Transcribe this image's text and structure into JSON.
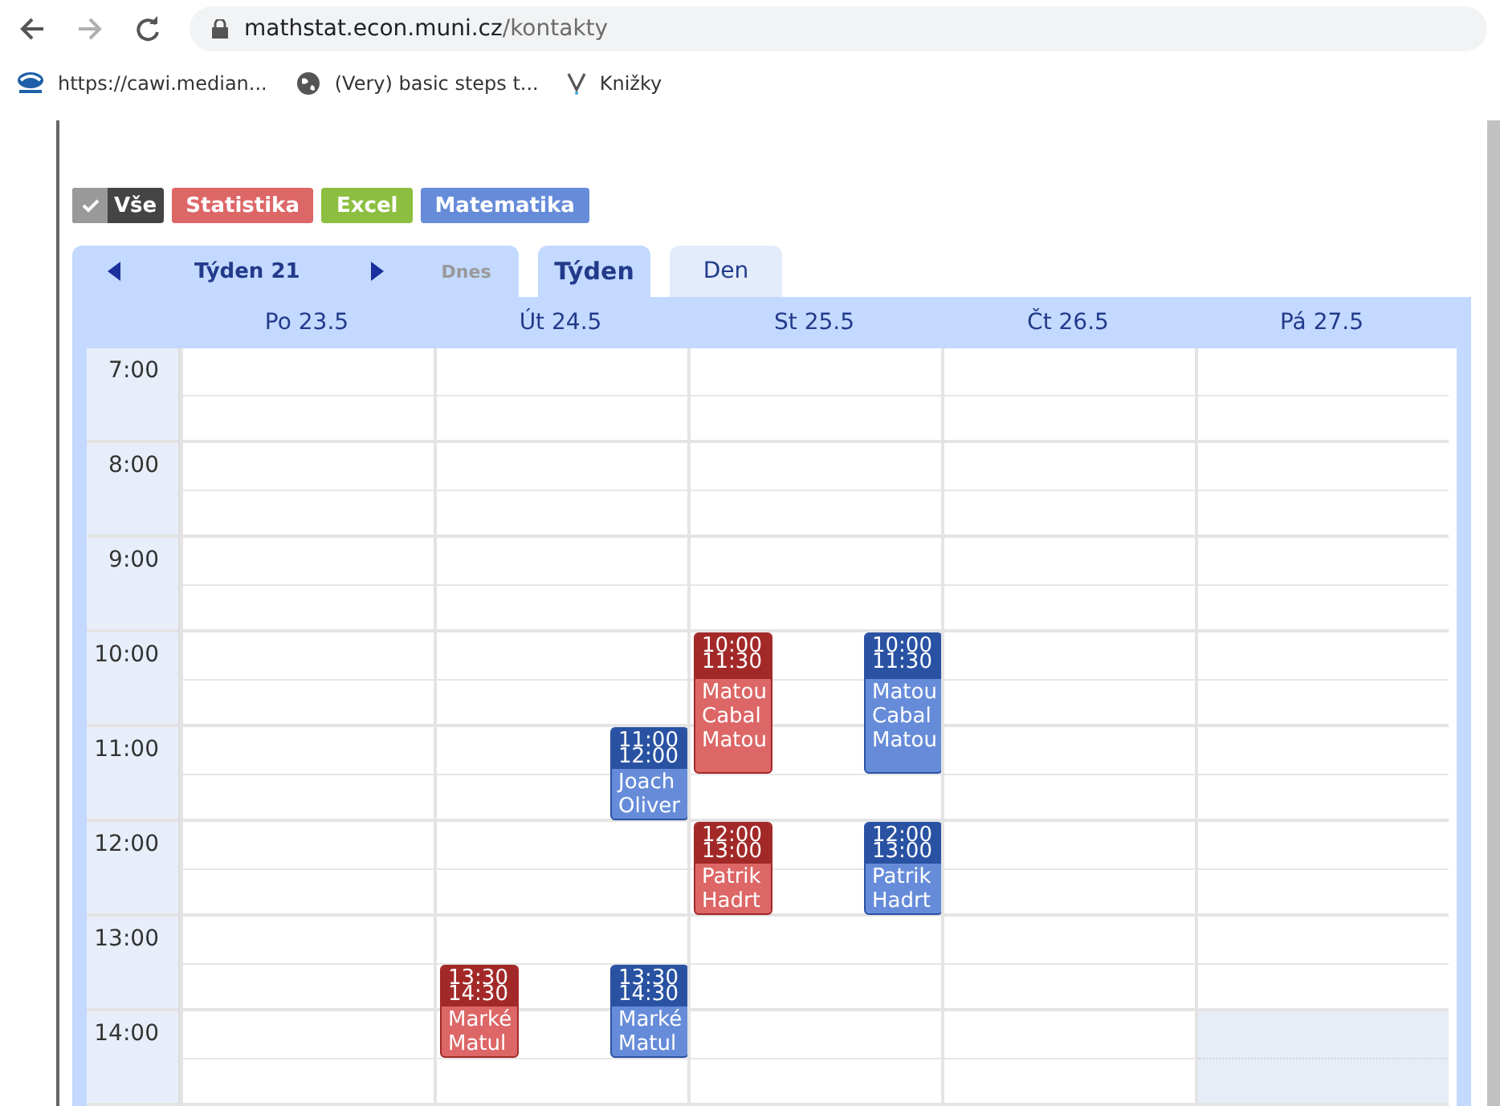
{
  "browser": {
    "url_host": "mathstat.econ.muni.cz",
    "url_path": "/kontakty",
    "forward_disabled": true,
    "bookmarks": [
      {
        "kind": "logo",
        "label": "https://cawi.median..."
      },
      {
        "kind": "globe",
        "label": "(Very) basic steps t..."
      },
      {
        "kind": "v",
        "label": "Knižky"
      }
    ]
  },
  "filters": [
    {
      "kind": "all",
      "label": "Vše",
      "checked": true,
      "color": "#444444"
    },
    {
      "kind": "category",
      "label": "Statistika",
      "color": "#dd6666"
    },
    {
      "kind": "category",
      "label": "Excel",
      "color": "#8cbf40"
    },
    {
      "kind": "category",
      "label": "Matematika",
      "color": "#668cd9"
    }
  ],
  "nav": {
    "week_label": "Týden 21",
    "today": {
      "label": "Dnes",
      "disabled": true
    },
    "views": [
      {
        "label": "Týden",
        "selected": true
      },
      {
        "label": "Den",
        "selected": false
      }
    ]
  },
  "days": [
    {
      "label": "Po 23.5"
    },
    {
      "label": "Út 24.5",
      "events": [
        {
          "kind": "mat",
          "color": "#2952a3",
          "time_start": "11:00",
          "time_end": "12:00",
          "lines": [
            "Joach",
            "Oliver"
          ]
        },
        {
          "kind": "stat",
          "color": "#a32929",
          "time_start": "13:30",
          "time_end": "14:30",
          "lines": [
            "Marké",
            "Matul"
          ]
        },
        {
          "kind": "mat",
          "color": "#2952a3",
          "time_start": "13:30",
          "time_end": "14:30",
          "lines": [
            "Marké",
            "Matul"
          ]
        }
      ]
    },
    {
      "label": "St 25.5",
      "events": [
        {
          "kind": "stat",
          "color": "#a32929",
          "time_start": "10:00",
          "time_end": "11:30",
          "lines": [
            "Matou",
            "Cabal",
            "Matou"
          ]
        },
        {
          "kind": "mat",
          "color": "#2952a3",
          "time_start": "10:00",
          "time_end": "11:30",
          "lines": [
            "Matou",
            "Cabal",
            "Matou"
          ]
        },
        {
          "kind": "stat",
          "color": "#a32929",
          "time_start": "12:00",
          "time_end": "13:00",
          "lines": [
            "Patrik",
            "Hadrt"
          ]
        },
        {
          "kind": "mat",
          "color": "#2952a3",
          "time_start": "12:00",
          "time_end": "13:00",
          "lines": [
            "Patrik",
            "Hadrt"
          ]
        }
      ]
    },
    {
      "label": "Čt 26.5"
    },
    {
      "label": "Pá 27.5"
    }
  ],
  "hours": [
    {
      "label": "7:00",
      "highlighted": [
        false,
        false,
        false,
        false,
        false
      ]
    },
    {
      "label": "8:00",
      "highlighted": [
        false,
        false,
        false,
        false,
        false
      ]
    },
    {
      "label": "9:00",
      "highlighted": [
        false,
        false,
        false,
        false,
        false
      ]
    },
    {
      "label": "10:00",
      "highlighted": [
        false,
        false,
        false,
        false,
        false
      ]
    },
    {
      "label": "11:00",
      "highlighted": [
        false,
        false,
        false,
        false,
        false
      ]
    },
    {
      "label": "12:00",
      "highlighted": [
        false,
        false,
        false,
        false,
        false
      ]
    },
    {
      "label": "13:00",
      "highlighted": [
        false,
        false,
        false,
        false,
        false
      ]
    },
    {
      "label": "14:00",
      "highlighted": [
        false,
        false,
        false,
        false,
        true
      ]
    }
  ]
}
